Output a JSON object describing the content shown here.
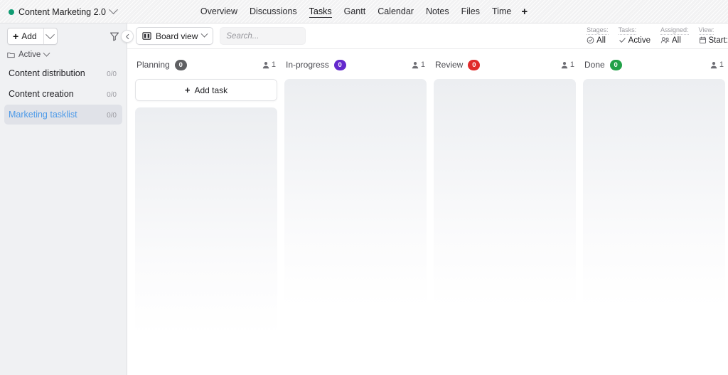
{
  "topbar": {
    "project_title": "Content Marketing 2.0",
    "project_status_color": "#0f9b72",
    "nav": [
      {
        "label": "Overview",
        "active": false
      },
      {
        "label": "Discussions",
        "active": false
      },
      {
        "label": "Tasks",
        "active": true
      },
      {
        "label": "Gantt",
        "active": false
      },
      {
        "label": "Calendar",
        "active": false
      },
      {
        "label": "Notes",
        "active": false
      },
      {
        "label": "Files",
        "active": false
      },
      {
        "label": "Time",
        "active": false
      }
    ],
    "add_tab_label": "+"
  },
  "sidebar": {
    "add_button_label": "Add",
    "add_button_plus": "+",
    "filter_icon": "filter-icon",
    "folder_label": "Active",
    "tasklists": [
      {
        "label": "Content distribution",
        "count": "0/0",
        "selected": false
      },
      {
        "label": "Content creation",
        "count": "0/0",
        "selected": false
      },
      {
        "label": "Marketing tasklist",
        "count": "0/0",
        "selected": true
      }
    ],
    "collapse_icon": "chevron-left-icon"
  },
  "toolbar": {
    "view_button_label": "Board view",
    "view_button_icon": "board-view-icon",
    "search_placeholder": "Search...",
    "search_value": "",
    "filters": [
      {
        "key": "Stages:",
        "value": "All",
        "icon": "check-circle-icon"
      },
      {
        "key": "Tasks:",
        "value": "Active",
        "icon": "check-icon"
      },
      {
        "key": "Assigned:",
        "value": "All",
        "icon": "people-icon"
      },
      {
        "key": "View:",
        "value": "Start:",
        "icon": "calendar-icon"
      }
    ]
  },
  "board": {
    "add_task_label": "Add task",
    "add_task_plus": "+",
    "columns": [
      {
        "title": "Planning",
        "badge": "0",
        "badge_color": "#5f6063",
        "assignees": "1",
        "has_add_task": true
      },
      {
        "title": "In-progress",
        "badge": "0",
        "badge_color": "#6429cd",
        "assignees": "1",
        "has_add_task": false
      },
      {
        "title": "Review",
        "badge": "0",
        "badge_color": "#e02b2b",
        "assignees": "1",
        "has_add_task": false
      },
      {
        "title": "Done",
        "badge": "0",
        "badge_color": "#21a148",
        "assignees": "1",
        "has_add_task": false
      }
    ]
  }
}
